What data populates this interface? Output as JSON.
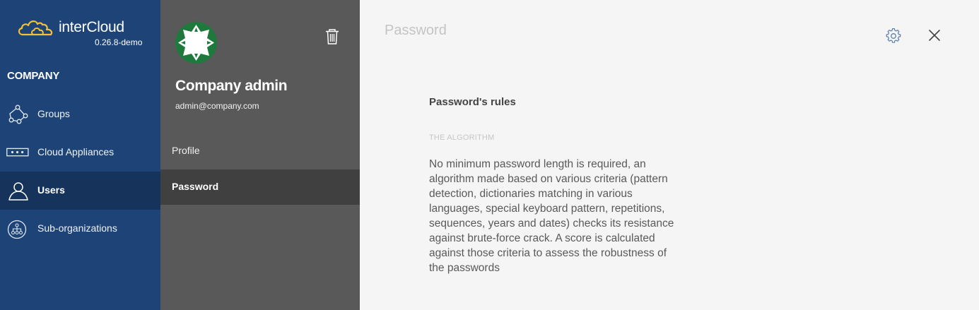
{
  "brand": {
    "name": "interCloud",
    "version": "0.26.8-demo"
  },
  "nav": {
    "section_title": "COMPANY",
    "items": [
      {
        "label": "Groups",
        "icon": "groups-icon",
        "active": false
      },
      {
        "label": "Cloud Appliances",
        "icon": "appliance-icon",
        "active": false
      },
      {
        "label": "Users",
        "icon": "user-icon",
        "active": true
      },
      {
        "label": "Sub-organizations",
        "icon": "sub-organizations-icon",
        "active": false
      }
    ]
  },
  "user": {
    "name": "Company admin",
    "email": "admin@company.com",
    "menu": [
      {
        "label": "Profile",
        "active": false
      },
      {
        "label": "Password",
        "active": true
      }
    ]
  },
  "content": {
    "title": "Password",
    "rules_title": "Password's rules",
    "algorithm_label": "THE ALGORITHM",
    "algorithm_text": "No minimum password length is required, an algorithm made based on various criteria (pattern detection, dictionaries matching in various languages, special keyboard pattern, repetitions, sequences, years and dates) checks its resistance against brute-force crack. A score is calculated against those criteria to assess the robustness of the passwords"
  },
  "colors": {
    "nav_bg": "#1e4477",
    "nav_active": "#15335b",
    "logo_accent": "#f2c233",
    "panel_bg": "#595959",
    "panel_active": "#404040",
    "avatar_green": "#1e7a3c",
    "content_bg": "#f5f5f5"
  }
}
